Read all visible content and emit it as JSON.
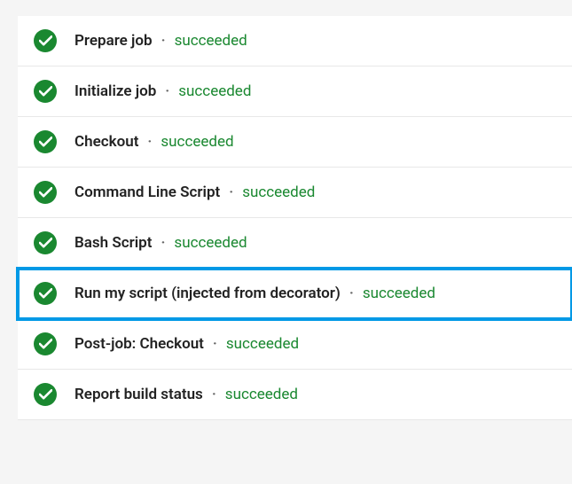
{
  "colors": {
    "success": "#1a8830",
    "highlight": "#0099e6"
  },
  "steps": [
    {
      "name": "Prepare job",
      "status": "succeeded",
      "highlighted": false
    },
    {
      "name": "Initialize job",
      "status": "succeeded",
      "highlighted": false
    },
    {
      "name": "Checkout",
      "status": "succeeded",
      "highlighted": false
    },
    {
      "name": "Command Line Script",
      "status": "succeeded",
      "highlighted": false
    },
    {
      "name": "Bash Script",
      "status": "succeeded",
      "highlighted": false
    },
    {
      "name": "Run my script (injected from decorator)",
      "status": "succeeded",
      "highlighted": true
    },
    {
      "name": "Post-job: Checkout",
      "status": "succeeded",
      "highlighted": false
    },
    {
      "name": "Report build status",
      "status": "succeeded",
      "highlighted": false
    }
  ],
  "separator": "·",
  "icon": "success-check"
}
